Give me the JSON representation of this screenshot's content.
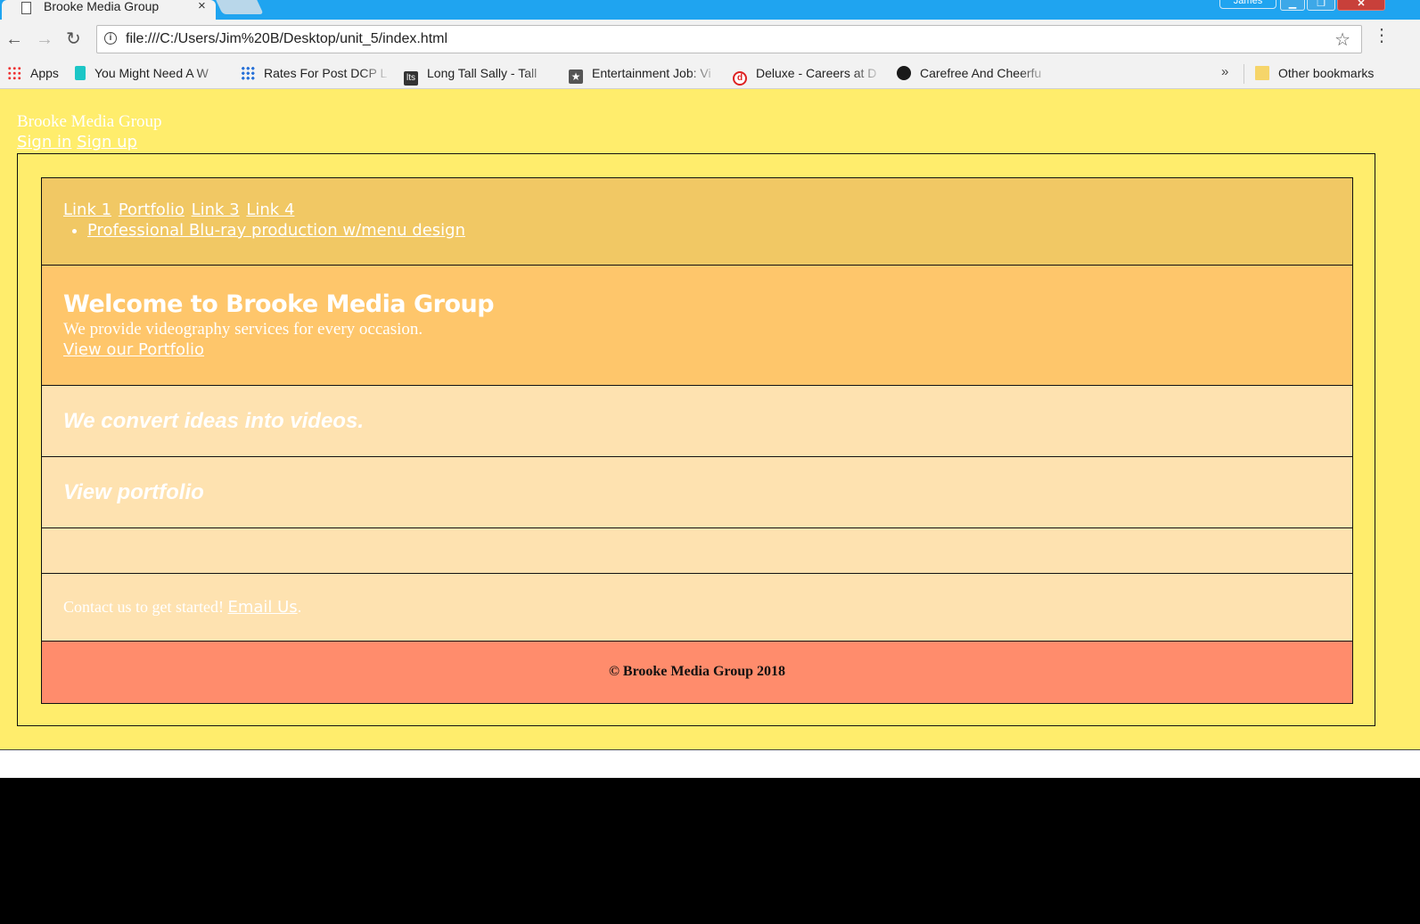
{
  "browser": {
    "tab_title": "Brooke Media Group",
    "tab_close": "×",
    "profile_name": "James",
    "url": "file:///C:/Users/Jim%20B/Desktop/unit_5/index.html",
    "bookmarks": [
      {
        "label": "Apps",
        "icon": "apps-grid-icon"
      },
      {
        "label": "You Might Need A W",
        "icon": "bookmark-favicon"
      },
      {
        "label": "Rates For Post DCP L",
        "icon": "grid-favicon"
      },
      {
        "label": "Long Tall Sally - Tall",
        "icon": "lts-favicon"
      },
      {
        "label": "Entertainment Job: Vi",
        "icon": "star-badge-favicon"
      },
      {
        "label": "Deluxe - Careers at D",
        "icon": "deluxe-favicon"
      },
      {
        "label": "Carefree And Cheerfu",
        "icon": "dark-circle-favicon"
      }
    ],
    "bookmarks_more": "»",
    "other_bookmarks": "Other bookmarks"
  },
  "site": {
    "title": "Brooke Media Group",
    "auth": {
      "sign_in": "Sign in",
      "sign_up": "Sign up"
    },
    "nav": {
      "links": [
        "Link 1",
        "Portfolio",
        "Link 3",
        "Link 4"
      ],
      "sublist": [
        "Professional Blu-ray production w/menu design"
      ]
    },
    "hero": {
      "heading": "Welcome to Brooke Media Group",
      "tagline": "We provide videography services for every occasion.",
      "link": "View our Portfolio"
    },
    "convert_text": "We convert ideas into videos.",
    "portfolio_text": "View portfolio",
    "contact": {
      "text": "Contact us to get started!",
      "link": "Email Us",
      "suffix": "."
    },
    "footer": "© Brooke Media Group 2018"
  },
  "colors": {
    "page_bg": "#ffed6c",
    "nav_bg": "#f1c864",
    "hero_bg": "#fec66b",
    "light_band_bg": "#fee2b0",
    "footer_bg": "#ff8c6c",
    "chrome_tabstrip": "#1fa4f0"
  }
}
